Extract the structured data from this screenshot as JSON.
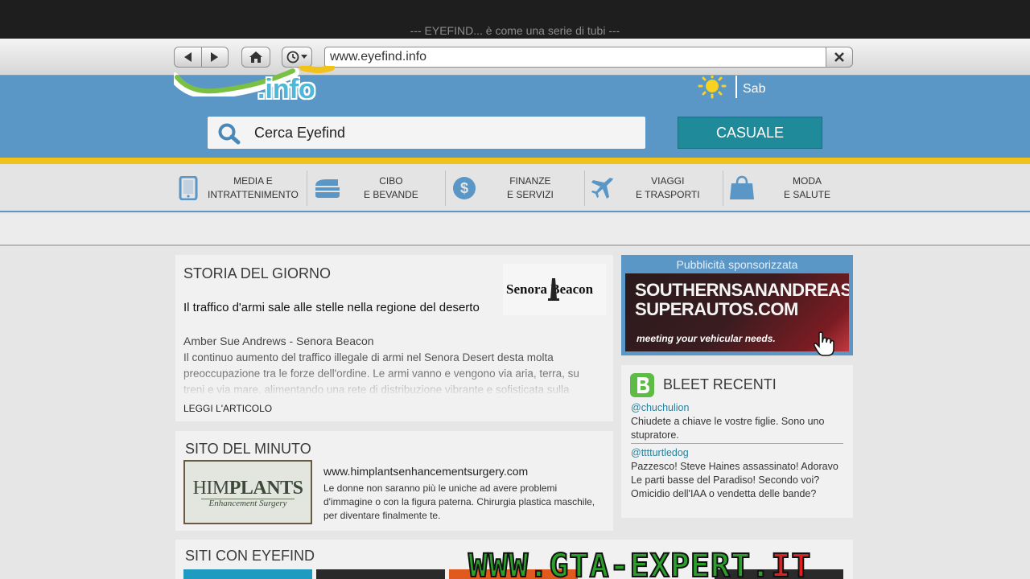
{
  "window": {
    "title": "--- EYEFIND... è come una serie di tubi ---"
  },
  "browser": {
    "url": "www.eyefind.info"
  },
  "header": {
    "logo_text": ".info",
    "weather_day": "Sab",
    "search_placeholder": "Cerca Eyefind",
    "random_label": "CASUALE"
  },
  "categories": [
    {
      "line1": "MEDIA E",
      "line2": "INTRATTENIMENTO",
      "icon": "tablet-icon"
    },
    {
      "line1": "CIBO",
      "line2": "E BEVANDE",
      "icon": "burger-icon"
    },
    {
      "line1": "FINANZE",
      "line2": "E SERVIZI",
      "icon": "dollar-icon"
    },
    {
      "line1": "VIAGGI",
      "line2": "E TRASPORTI",
      "icon": "airplane-icon"
    },
    {
      "line1": "MODA",
      "line2": "E SALUTE",
      "icon": "shopping-bag-icon"
    }
  ],
  "story": {
    "heading": "STORIA DEL GIORNO",
    "headline": "Il traffico d'armi sale alle stelle nella regione del deserto",
    "author": "Amber Sue Andrews - Senora Beacon",
    "body": "Il continuo aumento del traffico illegale di armi nel Senora Desert desta molta preoccupazione tra le forze dell'ordine. Le armi vanno e vengono via aria, terra, su treni e via mare, alimentando una rete di distribuzione vibrante e sofisticata sulla",
    "read_more": "LEGGI L'ARTICOLO",
    "source_logo": "Senora Beacon"
  },
  "site_of_minute": {
    "heading": "SITO DEL MINUTO",
    "logo_main": "HIM",
    "logo_bold": "PLANTS",
    "logo_sub": "Enhancement Surgery",
    "url": "www.himplantsenhancementsurgery.com",
    "description": "Le donne non saranno più le uniche ad avere problemi d'immagine o con la figura paterna. Chirurgia plastica maschile, per diventare finalmente te."
  },
  "sites_with_eyefind": {
    "heading": "SITI CON EYEFIND"
  },
  "ad": {
    "label": "Pubblicità sponsorizzata",
    "line1": "SOUTHERNSANANDREAS",
    "line2": "SUPERAUTOS.COM",
    "tagline": "meeting your vehicular needs."
  },
  "bleets": {
    "heading": "BLEET RECENTI",
    "items": [
      {
        "user": "@chuchulion",
        "text": "Chiudete a chiave le vostre figlie. Sono uno stupratore."
      },
      {
        "user": "@tttturtledog",
        "text": "Pazzesco! Steve Haines assassinato! Adoravo Le parti basse del Paradiso! Secondo voi? Omicidio dell'IAA o vendetta delle bande?"
      }
    ]
  },
  "watermark": {
    "main": "WWW.GTA-EXPERT.",
    "accent": "IT"
  },
  "colors": {
    "header_blue": "#5a96c6",
    "accent_yellow": "#f0c21a",
    "button_teal": "#1f8a9a"
  }
}
